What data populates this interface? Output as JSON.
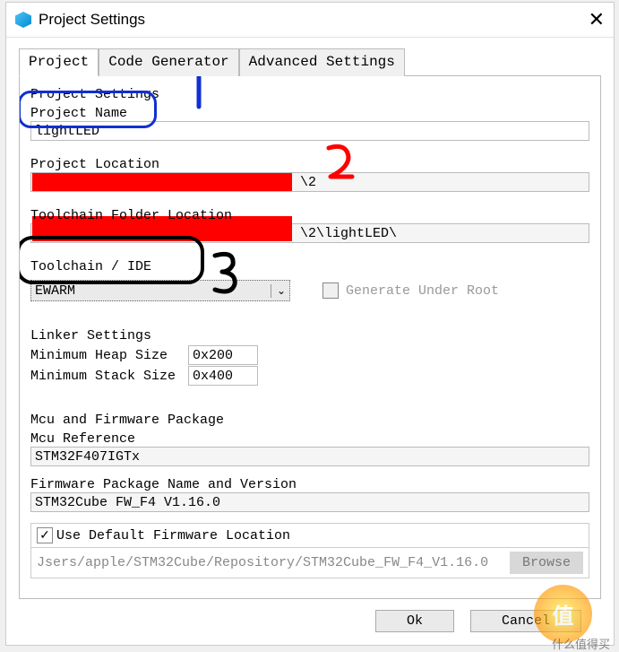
{
  "window": {
    "title": "Project Settings"
  },
  "tabs": {
    "project": "Project",
    "codegen": "Code Generator",
    "advanced": "Advanced Settings"
  },
  "project_settings": {
    "heading": "Project Settings",
    "name_label": "Project Name",
    "name_value": "lightLED",
    "location_label": "Project Location",
    "location_value_suffix": "\\2",
    "toolchain_folder_label": "Toolchain Folder Location",
    "toolchain_folder_value_suffix": "\\2\\lightLED\\",
    "toolchain_ide_label": "Toolchain / IDE",
    "toolchain_ide_value": "EWARM",
    "generate_under_root": "Generate Under Root"
  },
  "linker": {
    "heading": "Linker Settings",
    "min_heap_label": "Minimum Heap Size",
    "min_heap_value": "0x200",
    "min_stack_label": "Minimum Stack Size",
    "min_stack_value": "0x400"
  },
  "mcu": {
    "heading": "Mcu and Firmware Package",
    "ref_label": "Mcu Reference",
    "ref_value": "STM32F407IGTx",
    "fw_label": "Firmware Package Name and Version",
    "fw_value": "STM32Cube FW_F4 V1.16.0",
    "use_default_label": "Use Default Firmware Location",
    "fw_path": "Jsers/apple/STM32Cube/Repository/STM32Cube_FW_F4_V1.16.0",
    "browse": "Browse"
  },
  "buttons": {
    "ok": "Ok",
    "cancel": "Cancel"
  },
  "annotations": {
    "num1": "1",
    "num2": "2",
    "num3": "3"
  },
  "watermark": {
    "icon": "值",
    "text": "什么值得买"
  }
}
